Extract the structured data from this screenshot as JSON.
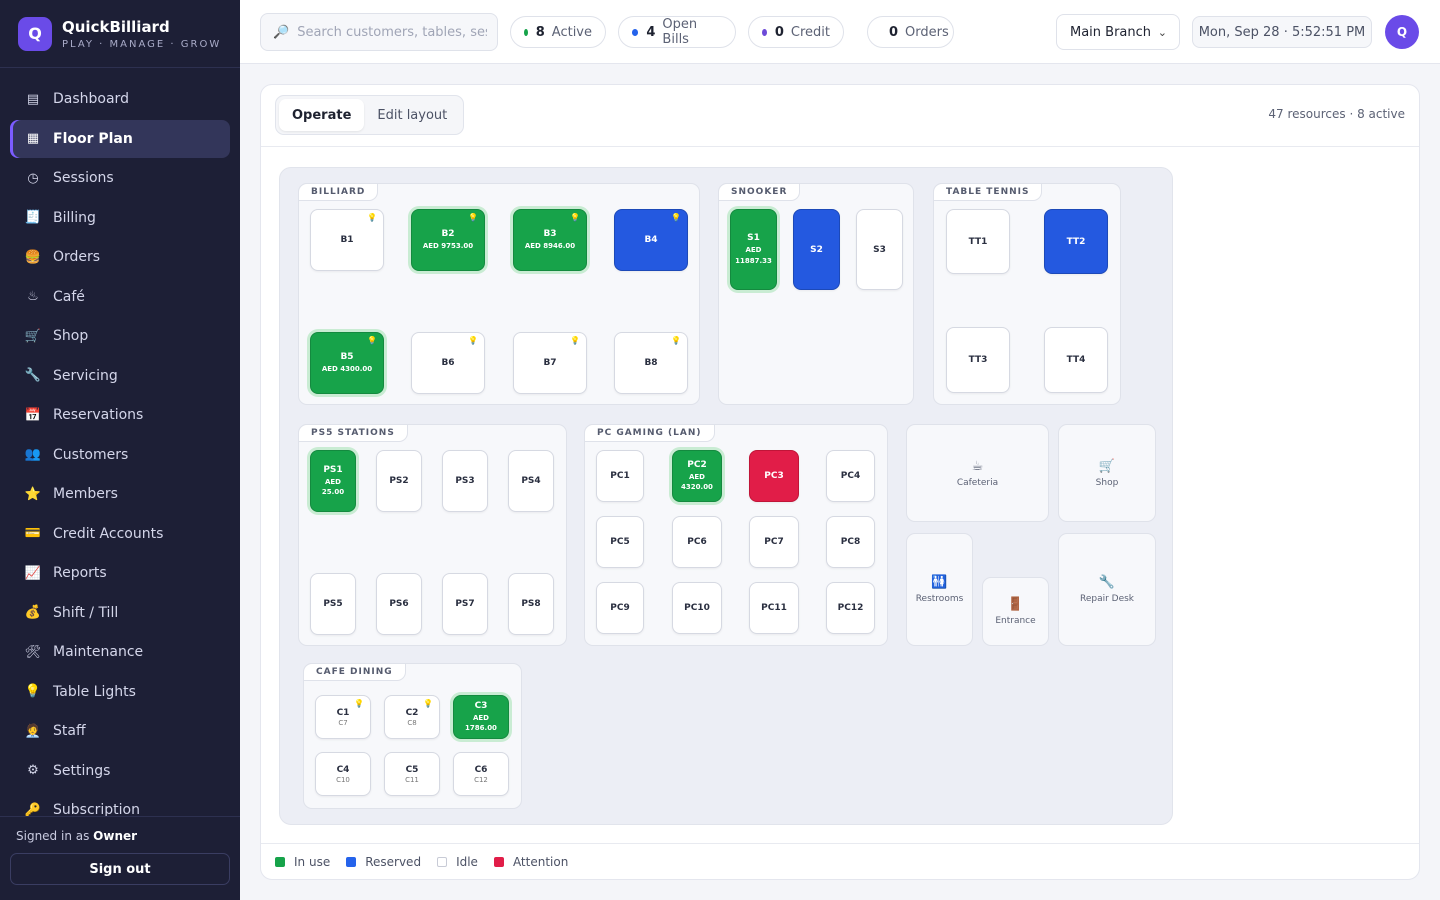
{
  "brand": {
    "logo": "Q",
    "name": "QuickBilliard",
    "tagline": "PLAY · MANAGE · GROW"
  },
  "nav": [
    {
      "icon": "▤",
      "label": "Dashboard"
    },
    {
      "icon": "▦",
      "label": "Floor Plan",
      "active": true
    },
    {
      "icon": "◷",
      "label": "Sessions"
    },
    {
      "icon": "🧾",
      "label": "Billing"
    },
    {
      "icon": "🍔",
      "label": "Orders"
    },
    {
      "icon": "♨",
      "label": "Café"
    },
    {
      "icon": "🛒",
      "label": "Shop"
    },
    {
      "icon": "🔧",
      "label": "Servicing"
    },
    {
      "icon": "📅",
      "label": "Reservations"
    },
    {
      "icon": "👥",
      "label": "Customers"
    },
    {
      "icon": "⭐",
      "label": "Members"
    },
    {
      "icon": "💳",
      "label": "Credit Accounts"
    },
    {
      "icon": "📈",
      "label": "Reports"
    },
    {
      "icon": "💰",
      "label": "Shift / Till"
    },
    {
      "icon": "🛠",
      "label": "Maintenance"
    },
    {
      "icon": "💡",
      "label": "Table Lights"
    },
    {
      "icon": "🧑‍💼",
      "label": "Staff"
    },
    {
      "icon": "⚙",
      "label": "Settings"
    },
    {
      "icon": "🔑",
      "label": "Subscription"
    }
  ],
  "footer": {
    "signed_prefix": "Signed in as ",
    "role": "Owner",
    "signout": "Sign out"
  },
  "topbar": {
    "search_icon": "🔎",
    "search_placeholder": "Search customers, tables, sessions",
    "pills": [
      {
        "count": "8",
        "label": "Active",
        "color": "#16a34a"
      },
      {
        "count": "4",
        "label": "Open Bills",
        "color": "#2563eb"
      },
      {
        "count": "0",
        "label": "Credit",
        "color": "#6d4bd8"
      },
      {
        "count": "0",
        "label": "Orders",
        "color": "#f59e0b"
      }
    ],
    "branch": "Main Branch",
    "datetime": "Mon, Sep 28 · 5:52:51 PM",
    "avatar": "Q"
  },
  "panel": {
    "tabs": [
      "Operate",
      "Edit layout"
    ],
    "resource_count": "47 resources · 8 active"
  },
  "zones": {
    "billiard": "BILLIARD",
    "snooker": "SNOOKER",
    "tabletennis": "TABLE TENNIS",
    "ps5": "PS5 STATIONS",
    "pc": "PC GAMING (LAN)",
    "cafe": "CAFE DINING"
  },
  "tables": {
    "b1": {
      "name": "B1"
    },
    "b2": {
      "name": "B2",
      "amount": "AED 9753.00"
    },
    "b3": {
      "name": "B3",
      "amount": "AED 8946.00"
    },
    "b4": {
      "name": "B4"
    },
    "b5": {
      "name": "B5",
      "amount": "AED 4300.00"
    },
    "b6": {
      "name": "B6"
    },
    "b7": {
      "name": "B7"
    },
    "b8": {
      "name": "B8"
    },
    "s1": {
      "name": "S1",
      "amount": "AED 11887.33"
    },
    "s2": {
      "name": "S2"
    },
    "s3": {
      "name": "S3"
    },
    "tt1": {
      "name": "TT1"
    },
    "tt2": {
      "name": "TT2"
    },
    "tt3": {
      "name": "TT3"
    },
    "tt4": {
      "name": "TT4"
    },
    "ps1": {
      "name": "PS1",
      "amount": "AED 25.00"
    },
    "ps2": {
      "name": "PS2"
    },
    "ps3": {
      "name": "PS3"
    },
    "ps4": {
      "name": "PS4"
    },
    "ps5": {
      "name": "PS5"
    },
    "ps6": {
      "name": "PS6"
    },
    "ps7": {
      "name": "PS7"
    },
    "ps8": {
      "name": "PS8"
    },
    "pc1": {
      "name": "PC1"
    },
    "pc2": {
      "name": "PC2",
      "amount": "AED 4320.00"
    },
    "pc3": {
      "name": "PC3"
    },
    "pc4": {
      "name": "PC4"
    },
    "pc5": {
      "name": "PC5"
    },
    "pc6": {
      "name": "PC6"
    },
    "pc7": {
      "name": "PC7"
    },
    "pc8": {
      "name": "PC8"
    },
    "pc9": {
      "name": "PC9"
    },
    "pc10": {
      "name": "PC10"
    },
    "pc11": {
      "name": "PC11"
    },
    "pc12": {
      "name": "PC12"
    },
    "c1": {
      "name": "C1",
      "sub": "C7"
    },
    "c2": {
      "name": "C2",
      "sub": "C8"
    },
    "c3": {
      "name": "C3",
      "amount": "AED 1786.00"
    },
    "c4": {
      "name": "C4",
      "sub": "C10"
    },
    "c5": {
      "name": "C5",
      "sub": "C11"
    },
    "c6": {
      "name": "C6",
      "sub": "C12"
    }
  },
  "facilities": {
    "cafeteria": {
      "icon": "☕",
      "label": "Cafeteria"
    },
    "shop": {
      "icon": "🛒",
      "label": "Shop"
    },
    "restrooms": {
      "icon": "🚻",
      "label": "Restrooms"
    },
    "entrance": {
      "icon": "🚪",
      "label": "Entrance"
    },
    "repair": {
      "icon": "🔧",
      "label": "Repair Desk"
    }
  },
  "legend": [
    {
      "label": "In use",
      "color": "#16a34a"
    },
    {
      "label": "Reserved",
      "color": "#2563eb"
    },
    {
      "label": "Idle",
      "color": "#ffffff"
    },
    {
      "label": "Attention",
      "color": "#e11d48"
    }
  ],
  "bulb_icon": "💡"
}
